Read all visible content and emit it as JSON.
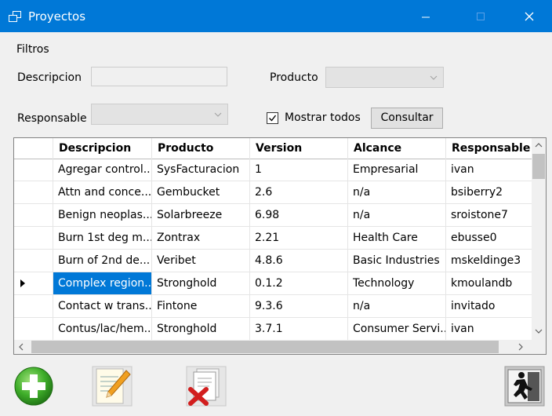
{
  "window": {
    "title": "Proyectos",
    "title_bar_color": "#0078d7",
    "icons": [
      "app-icon",
      "minimize-icon",
      "maximize-icon",
      "close-icon"
    ]
  },
  "filters": {
    "group_label": "Filtros",
    "descripcion_label": "Descripcion",
    "descripcion_value": "",
    "producto_label": "Producto",
    "producto_value": "",
    "responsable_label": "Responsable",
    "responsable_value": "",
    "mostrar_todos_label": "Mostrar todos",
    "mostrar_todos_checked": true,
    "consultar_label": "Consultar"
  },
  "grid": {
    "columns": [
      "Descripcion",
      "Producto",
      "Version",
      "Alcance",
      "Responsable"
    ],
    "rows": [
      [
        "Agregar control...",
        "SysFacturacion",
        "1",
        "Empresarial",
        "ivan"
      ],
      [
        "Attn and conce...",
        "Gembucket",
        "2.6",
        "n/a",
        "bsiberry2"
      ],
      [
        "Benign neoplas...",
        "Solarbreeze",
        "6.98",
        "n/a",
        "sroistone7"
      ],
      [
        "Burn 1st deg m...",
        "Zontrax",
        "2.21",
        "Health Care",
        "ebusse0"
      ],
      [
        "Burn of 2nd de...",
        "Veribet",
        "4.8.6",
        "Basic Industries",
        "mskeldinge3"
      ],
      [
        "Complex region...",
        "Stronghold",
        "0.1.2",
        "Technology",
        "kmoulandb"
      ],
      [
        "Contact w trans...",
        "Fintone",
        "9.3.6",
        "n/a",
        "invitado"
      ],
      [
        "Contus/lac/hem...",
        "Stronghold",
        "3.7.1",
        "Consumer Servi...",
        "ivan"
      ]
    ],
    "selected_row": 5,
    "selection_color": "#0078d7"
  },
  "toolbar": {
    "icons": [
      "add-icon",
      "edit-icon",
      "delete-icon",
      "exit-icon"
    ]
  }
}
